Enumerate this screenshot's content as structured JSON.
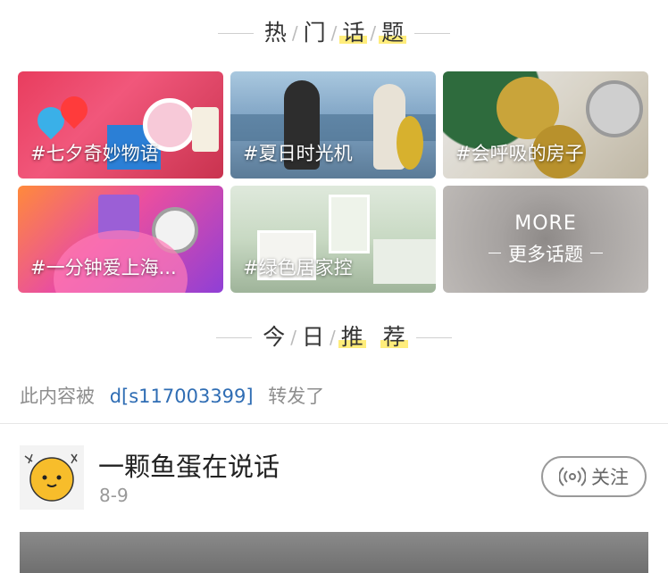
{
  "hot_topics": {
    "title_chars": [
      "热",
      "门",
      "话",
      "题"
    ],
    "tiles": [
      {
        "label": "#七夕奇妙物语"
      },
      {
        "label": "#夏日时光机"
      },
      {
        "label": "#会呼吸的房子"
      },
      {
        "label": "#一分钟爱上海..."
      },
      {
        "label": "#绿色居家控"
      }
    ],
    "more": {
      "en": "MORE",
      "zh": "更多话题"
    }
  },
  "today": {
    "title_chars": [
      "今",
      "日",
      "推",
      "荐"
    ]
  },
  "post": {
    "forward_prefix": "此内容被",
    "forward_user": "d[s117003399]",
    "forward_suffix": "转发了",
    "author": "一颗鱼蛋在说话",
    "date": "8-9",
    "follow_label": "关注"
  },
  "colors": {
    "accent_highlight": "#ffe85a",
    "link_blue": "#2f6db4"
  }
}
